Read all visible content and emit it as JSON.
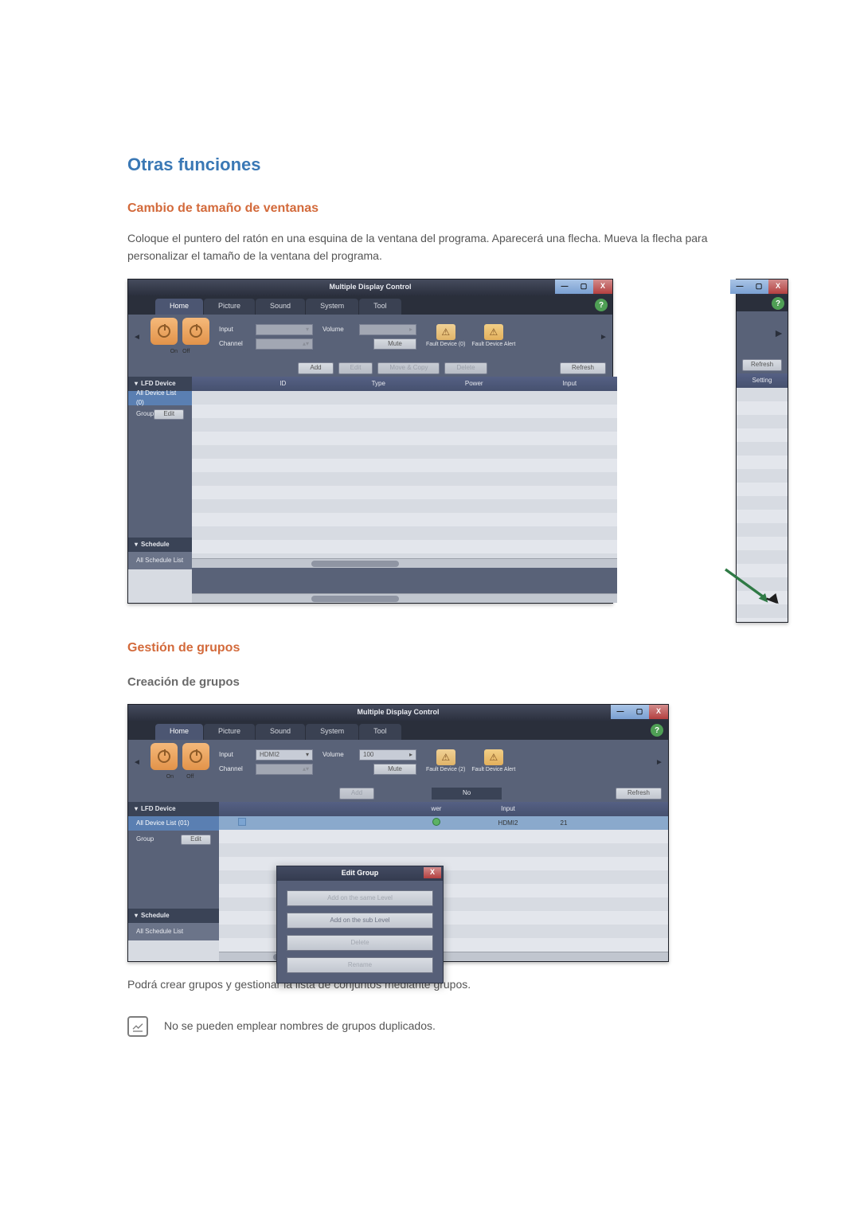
{
  "headings": {
    "main": "Otras funciones",
    "sub1": "Cambio de tamaño de ventanas",
    "sub2": "Gestión de grupos",
    "sub3": "Creación de grupos"
  },
  "paragraphs": {
    "p1": "Coloque el puntero del ratón en una esquina de la ventana del programa. Aparecerá una flecha. Mueva la flecha para personalizar el tamaño de la ventana del programa.",
    "p2": "Podrá crear grupos y gestionar la lista de conjuntos mediante grupos.",
    "note": "No se pueden emplear nombres de grupos duplicados."
  },
  "app": {
    "title": "Multiple Display Control",
    "tabs": {
      "home": "Home",
      "picture": "Picture",
      "sound": "Sound",
      "system": "System",
      "tool": "Tool"
    },
    "ribbon": {
      "on": "On",
      "off": "Off",
      "input_label": "Input",
      "channel_label": "Channel",
      "input_value": "HDMI2",
      "volume_label": "Volume",
      "volume_value": "100",
      "mute": "Mute",
      "fault0": "Fault Device (0)",
      "fault2": "Fault Device (2)",
      "fault_alert": "Fault Device Alert"
    },
    "toolbar": {
      "add": "Add",
      "edit": "Edit",
      "move": "Move & Copy",
      "delete": "Delete",
      "refresh": "Refresh"
    },
    "sidebar": {
      "lfd": "LFD Device",
      "all_list_0": "All Device List (0)",
      "all_list_1": "All Device List (01)",
      "group": "Group",
      "edit": "Edit",
      "schedule": "Schedule",
      "all_schedule": "All Schedule List"
    },
    "columns": {
      "id": "ID",
      "type": "Type",
      "power": "Power",
      "input": "Input",
      "setting": "Setting",
      "no": "No"
    },
    "extra": {
      "refresh": "Refresh",
      "setting": "Setting"
    },
    "popup": {
      "title": "Edit Group",
      "b1": "Add on the same Level",
      "b2": "Add on the sub Level",
      "b3": "Delete",
      "b4": "Rename"
    },
    "row": {
      "wer": "wer",
      "hdmi2": "HDMI2",
      "num": "21"
    }
  }
}
